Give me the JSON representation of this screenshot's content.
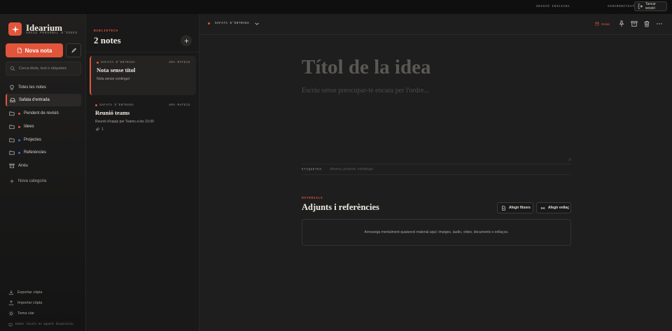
{
  "topbar": {
    "session": "SESSIÓ INICIADA",
    "sync": "SINCRONITZAT",
    "logout_label": "Tancar sessió"
  },
  "sidebar": {
    "brand": "Idearium",
    "brand_sub": "ARXIU PERSONAL D'IDEES",
    "new_note_label": "Nova nota",
    "search_placeholder": "Cerca títols, text o etiquetes",
    "items": [
      {
        "label": "Totes les notes",
        "icon": "lightbulb-icon"
      },
      {
        "label": "Safata d'entrada",
        "icon": "inbox-icon",
        "active": true
      },
      {
        "label": "Pendent de revisió",
        "icon": "folder-icon",
        "color": "#e2553b"
      },
      {
        "label": "Idees",
        "icon": "folder-icon",
        "color": "#e2553b"
      },
      {
        "label": "Projectes",
        "icon": "folder-icon",
        "color": "#3b6fe2"
      },
      {
        "label": "Referències",
        "icon": "folder-icon",
        "color": "#3b6fe2"
      },
      {
        "label": "Arxiu",
        "icon": "archive-icon"
      }
    ],
    "new_category_label": "Nova categoria",
    "export_label": "Exportar còpia",
    "import_label": "Importar còpia",
    "theme_label": "Tema clar",
    "local_note": "Dades locals en aquest dispositiu"
  },
  "list": {
    "section_label": "BIBLIOTECA",
    "count_title": "2 notes",
    "notes": [
      {
        "folder": "SAFATA D'ENTRADA",
        "time": "ARA MATEIX",
        "title": "Nota sense títol",
        "body": "Nota sense contingut"
      },
      {
        "folder": "SAFATA D'ENTRADA",
        "time": "ARA MATEIX",
        "title": "Reunió teams",
        "body": "Reunió d'equip per Teams a les 10:30",
        "attachments": "1"
      }
    ]
  },
  "editor": {
    "folder": "SAFATA D'ENTRADA",
    "saved_label": "Desat",
    "title_placeholder": "Títol de la idea",
    "body_placeholder": "Escriu sense preocupar-te encara per l'ordre...",
    "tags_label": "ETIQUETES",
    "tags_placeholder": "disseny, projecte, estratègia",
    "materials_label": "MATERIALS",
    "materials_title": "Adjunts i referències",
    "add_file_label": "Afegir fitxers",
    "add_link_label": "Afegir enllaç",
    "dropzone_text": "Arrossega mentalment qualsevol material aquí: imatges, àudio, vídeo, documents o enllaços."
  },
  "colors": {
    "accent": "#e2553b",
    "blue": "#3b6fe2"
  }
}
